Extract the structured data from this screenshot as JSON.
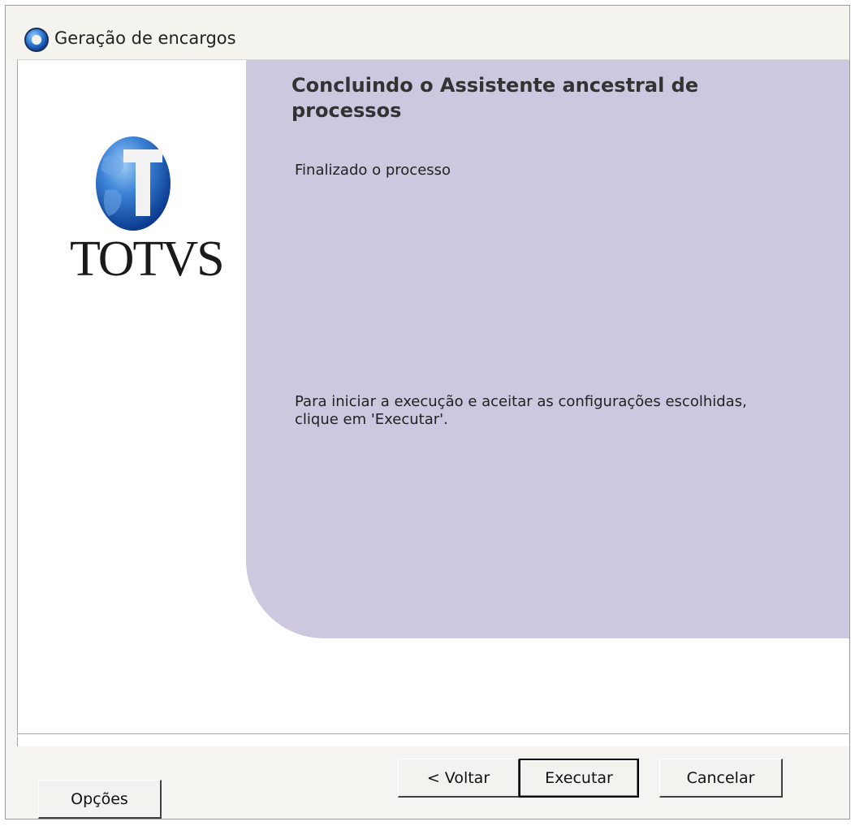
{
  "window": {
    "title": "Geração de encargos"
  },
  "logo": {
    "text": "TOTVS"
  },
  "panel": {
    "heading": "Concluindo o Assistente ancestral de processos",
    "status": "Finalizado o processo",
    "instruction": "Para iniciar a execução e aceitar as configurações escolhidas, clique em 'Executar'."
  },
  "buttons": {
    "options": "Opções",
    "back": "< Voltar",
    "execute": "Executar",
    "cancel": "Cancelar"
  },
  "colors": {
    "panel_background": "#cec7e0",
    "logo_blue": "#1f5fbf"
  },
  "icons": {
    "title": "totvs-globe-icon",
    "logo": "totvs-globe-logo"
  }
}
